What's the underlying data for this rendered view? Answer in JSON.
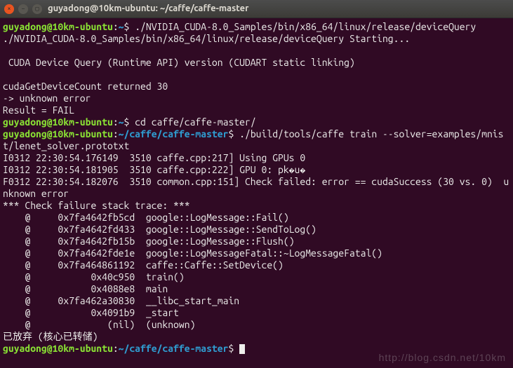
{
  "window": {
    "title": "guyadong@10km-ubuntu: ~/caffe/caffe-master"
  },
  "prompt1": {
    "user_host": "guyadong@10km-ubuntu",
    "sep": ":",
    "path": "~",
    "dollar": "$ "
  },
  "prompt2": {
    "user_host": "guyadong@10km-ubuntu",
    "sep": ":",
    "path": "~",
    "dollar": "$ "
  },
  "prompt3": {
    "user_host": "guyadong@10km-ubuntu",
    "sep": ":",
    "path": "~/caffe/caffe-master",
    "dollar": "$ "
  },
  "prompt4": {
    "user_host": "guyadong@10km-ubuntu",
    "sep": ":",
    "path": "~/caffe/caffe-master",
    "dollar": "$ "
  },
  "cmd1": "./NVIDIA_CUDA-8.0_Samples/bin/x86_64/linux/release/deviceQuery",
  "cmd2": "cd caffe/caffe-master/",
  "cmd3": "./build/tools/caffe train --solver=examples/mnist/lenet_solver.prototxt",
  "out": {
    "l1": "./NVIDIA_CUDA-8.0_Samples/bin/x86_64/linux/release/deviceQuery Starting...",
    "l2": "",
    "l3": " CUDA Device Query (Runtime API) version (CUDART static linking)",
    "l4": "",
    "l5": "cudaGetDeviceCount returned 30",
    "l6": "-> unknown error",
    "l7": "Result = FAIL",
    "l8": "I0312 22:30:54.176149  3510 caffe.cpp:217] Using GPUs 0",
    "l9": "I0312 22:30:54.181905  3510 caffe.cpp:222] GPU 0: pk�u�",
    "l10": "F0312 22:30:54.182076  3510 common.cpp:151] Check failed: error == cudaSuccess (30 vs. 0)  unknown error",
    "l11": "*** Check failure stack trace: ***",
    "l12": "    @     0x7fa4642fb5cd  google::LogMessage::Fail()",
    "l13": "    @     0x7fa4642fd433  google::LogMessage::SendToLog()",
    "l14": "    @     0x7fa4642fb15b  google::LogMessage::Flush()",
    "l15": "    @     0x7fa4642fde1e  google::LogMessageFatal::~LogMessageFatal()",
    "l16": "    @     0x7fa464861192  caffe::Caffe::SetDevice()",
    "l17": "    @           0x40c950  train()",
    "l18": "    @           0x4088e8  main",
    "l19": "    @     0x7fa462a30830  __libc_start_main",
    "l20": "    @           0x4091b9  _start",
    "l21": "    @              (nil)  (unknown)",
    "l22": "已放弃 (核心已转储)"
  },
  "watermark": "http://blog.csdn.net/10km"
}
